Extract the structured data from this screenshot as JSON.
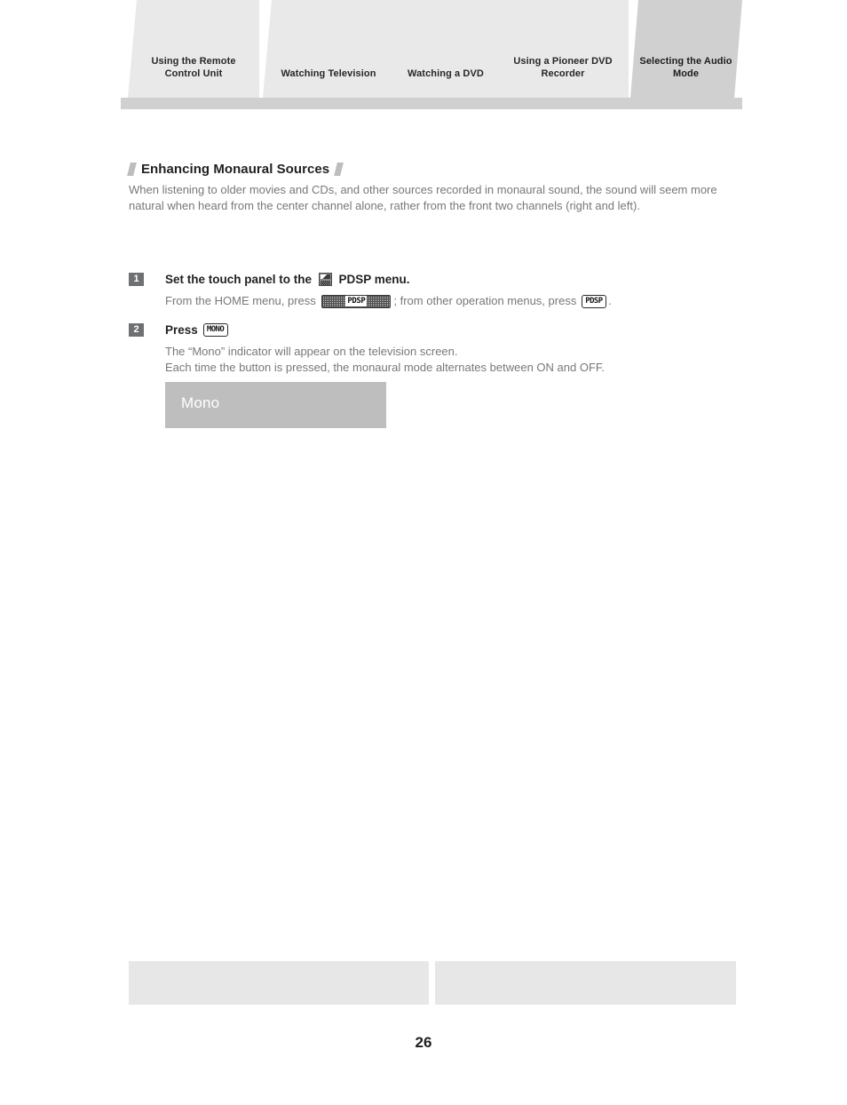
{
  "document": {
    "page_number": "26"
  },
  "tabs": [
    {
      "label": "Using the Remote Control Unit",
      "active": false
    },
    {
      "label": "Watching Television",
      "active": false
    },
    {
      "label": "Watching a DVD",
      "active": false
    },
    {
      "label": "Using a Pioneer DVD Recorder",
      "active": false
    },
    {
      "label": "Selecting the Audio Mode",
      "active": true
    }
  ],
  "section": {
    "title": "Enhancing Monaural Sources",
    "intro": "When listening to older movies and CDs, and other sources recorded in monaural sound, the sound will seem more natural when heard from the center channel alone, rather from the front two channels (right and left)."
  },
  "steps": [
    {
      "number": "1",
      "title_before_icon": "Set the touch panel to the ",
      "icon_name": "touch-panel-icon",
      "title_after_icon": " PDSP menu.",
      "desc_part_1": "From the HOME menu, press ",
      "key_wide_label": "PDSP",
      "desc_part_2": "; from other operation menus, press ",
      "key_small_label": "PDSP",
      "desc_part_3": "."
    },
    {
      "number": "2",
      "title_before_key": "Press ",
      "key_label": "MONO",
      "desc_line_1": "The “Mono” indicator will appear on the television screen.",
      "desc_line_2": "Each time the button is pressed, the monaural mode alternates between ON and OFF."
    }
  ],
  "screen_illustration": {
    "indicator_label": "Mono",
    "background_color": "#bebebe",
    "text_color": "#ffffff"
  },
  "colors": {
    "tab_inactive": "#e9e9e9",
    "tab_active": "#d0d0d0",
    "heading_text": "#231f20",
    "body_text": "#76787a",
    "step_badge": "#6e7073",
    "footer_box": "#e7e7e7"
  }
}
